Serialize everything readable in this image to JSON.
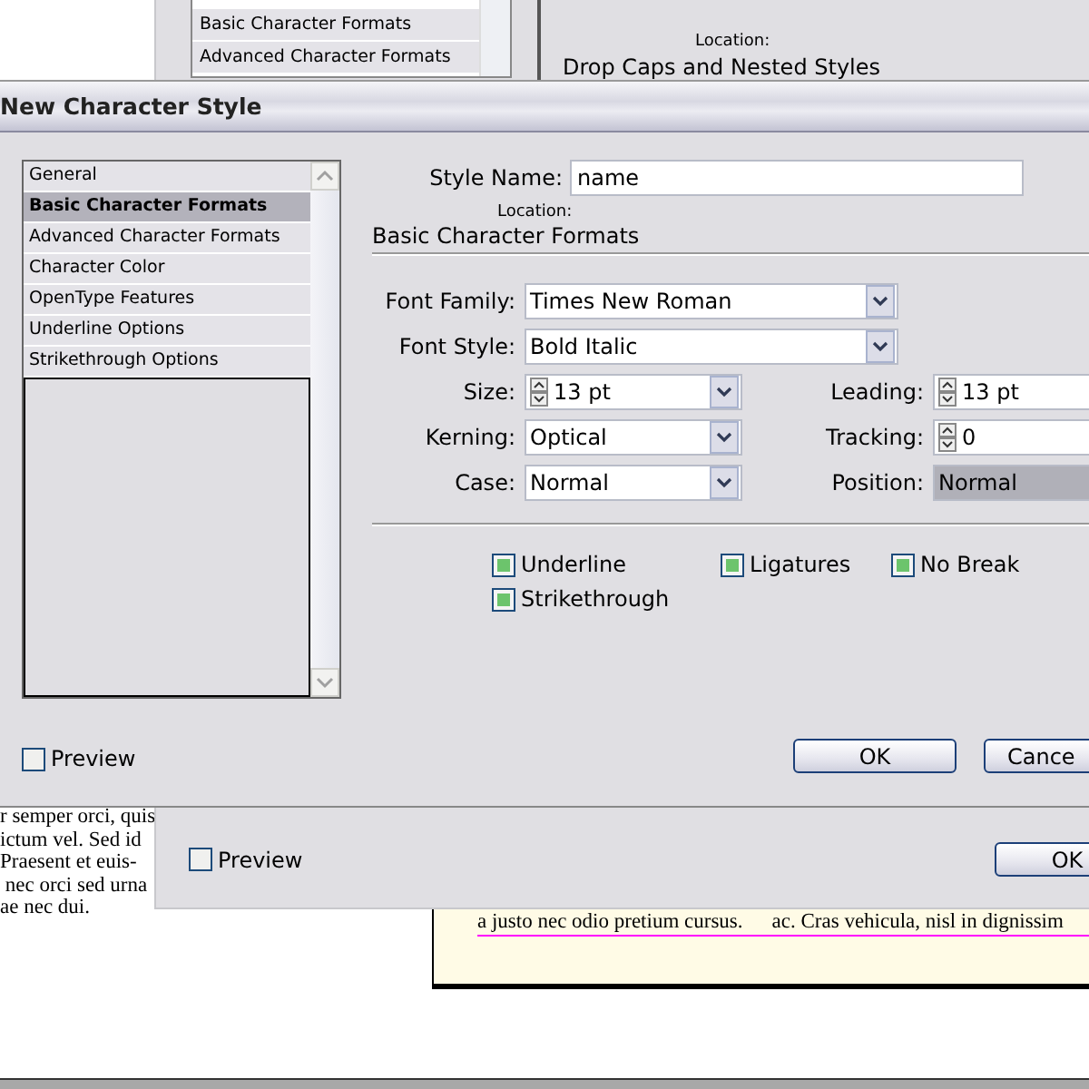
{
  "document": {
    "column_text": [
      "r semper orci, quis",
      "ictum vel. Sed id",
      "Praesent et euis-",
      " nec orci sed urna",
      "ae nec dui."
    ],
    "page_text": [
      "a justo nec odio pretium cursus.",
      "ac. Cras vehicula, nisl in dignissim"
    ]
  },
  "back_dialog": {
    "list_items": [
      {
        "label": "Basic Character Formats",
        "selected": false
      },
      {
        "label": "Advanced Character Formats",
        "selected": false
      }
    ],
    "location_label": "Location:",
    "location_value": "Drop Caps and Nested Styles",
    "preview": {
      "label": "Preview",
      "checked": false
    },
    "ok_button": "OK"
  },
  "dialog": {
    "title": "New Character Style",
    "list_items": [
      {
        "label": "General",
        "selected": false
      },
      {
        "label": "Basic Character Formats",
        "selected": true
      },
      {
        "label": "Advanced Character Formats",
        "selected": false
      },
      {
        "label": "Character Color",
        "selected": false
      },
      {
        "label": "OpenType Features",
        "selected": false
      },
      {
        "label": "Underline Options",
        "selected": false
      },
      {
        "label": "Strikethrough Options",
        "selected": false
      }
    ],
    "style_name": {
      "label": "Style Name:",
      "value": "name"
    },
    "location_label": "Location:",
    "section_title": "Basic Character Formats",
    "rows": [
      [
        {
          "label": "Font Family:",
          "value": "Times New Roman",
          "kind": "dropdown",
          "highlighted": false
        }
      ],
      [
        {
          "label": "Font Style:",
          "value": "Bold Italic",
          "kind": "dropdown",
          "highlighted": false
        }
      ],
      [
        {
          "label": "Size:",
          "value": "13 pt",
          "kind": "spin-dropdown",
          "highlighted": false
        },
        {
          "label": "Leading:",
          "value": "13 pt",
          "kind": "spin-dropdown",
          "highlighted": false
        }
      ],
      [
        {
          "label": "Kerning:",
          "value": "Optical",
          "kind": "dropdown",
          "highlighted": false
        },
        {
          "label": "Tracking:",
          "value": "0",
          "kind": "spinner",
          "highlighted": false
        }
      ],
      [
        {
          "label": "Case:",
          "value": "Normal",
          "kind": "dropdown",
          "highlighted": false
        },
        {
          "label": "Position:",
          "value": "Normal",
          "kind": "dropdown",
          "highlighted": true
        }
      ]
    ],
    "options": [
      {
        "label": "Underline",
        "checked": true
      },
      {
        "label": "Ligatures",
        "checked": true
      },
      {
        "label": "No Break",
        "checked": true
      },
      {
        "label": "Strikethrough",
        "checked": true
      }
    ],
    "preview": {
      "label": "Preview",
      "checked": false
    },
    "buttons": [
      "OK",
      "Cance"
    ]
  }
}
